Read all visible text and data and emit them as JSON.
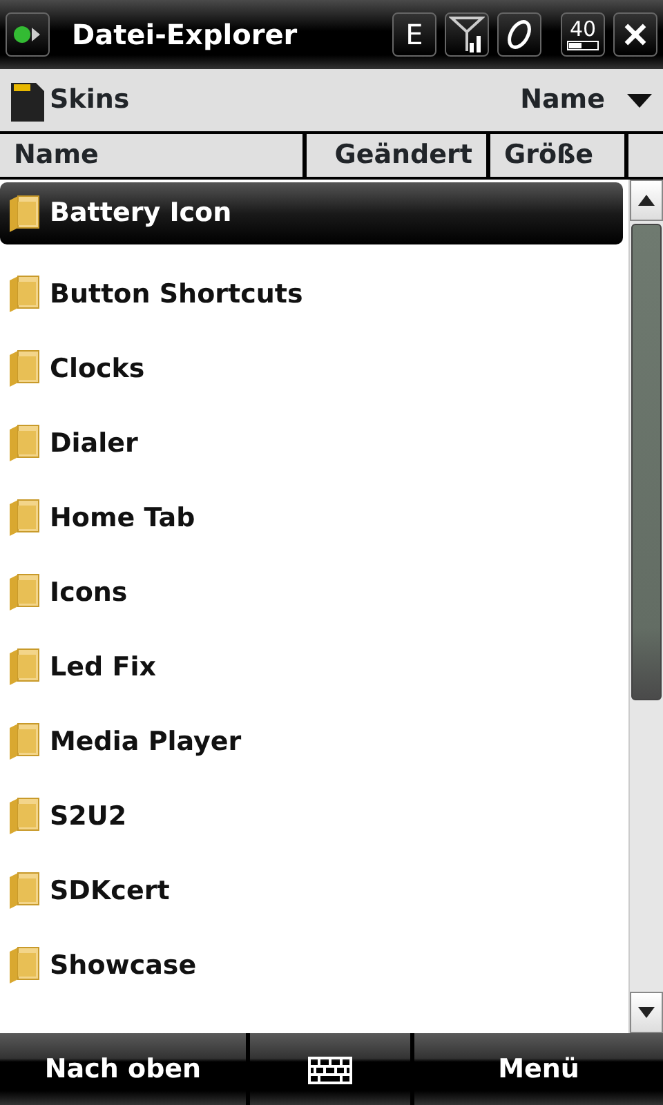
{
  "title_bar": {
    "title": "Datei-Explorer",
    "network_type": "E",
    "battery_text": "40"
  },
  "location": {
    "folder": "Skins",
    "sort": "Name"
  },
  "table": {
    "columns": [
      "Name",
      "Geändert",
      "Größe"
    ],
    "rows": [
      {
        "name": "Battery Icon",
        "selected": true
      },
      {
        "name": "Button Shortcuts",
        "selected": false
      },
      {
        "name": "Clocks",
        "selected": false
      },
      {
        "name": "Dialer",
        "selected": false
      },
      {
        "name": "Home Tab",
        "selected": false
      },
      {
        "name": "Icons",
        "selected": false
      },
      {
        "name": "Led Fix",
        "selected": false
      },
      {
        "name": "Media Player",
        "selected": false
      },
      {
        "name": "S2U2",
        "selected": false
      },
      {
        "name": "SDKcert",
        "selected": false
      },
      {
        "name": "Showcase",
        "selected": false
      }
    ]
  },
  "softkeys": {
    "left": "Nach oben",
    "right": "Menü"
  }
}
